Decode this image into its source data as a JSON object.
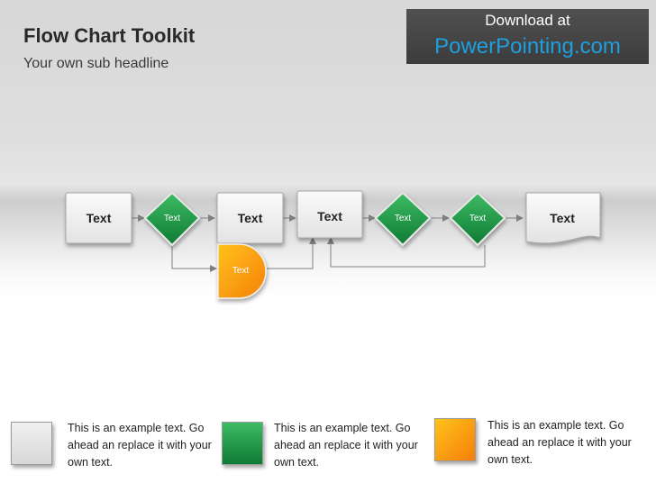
{
  "header": {
    "title": "Flow Chart Toolkit",
    "subtitle": "Your own sub headline"
  },
  "banner": {
    "line1": "Download at",
    "line2": "PowerPointing.com"
  },
  "flow": {
    "nodes": [
      {
        "id": "process-1",
        "shape": "process",
        "label": "Text"
      },
      {
        "id": "decision-1",
        "shape": "decision",
        "label": "Text"
      },
      {
        "id": "process-2",
        "shape": "process",
        "label": "Text"
      },
      {
        "id": "process-3",
        "shape": "process",
        "label": "Text"
      },
      {
        "id": "decision-2",
        "shape": "decision",
        "label": "Text"
      },
      {
        "id": "decision-3",
        "shape": "decision",
        "label": "Text"
      },
      {
        "id": "document-1",
        "shape": "document",
        "label": "Text"
      },
      {
        "id": "delay-1",
        "shape": "delay",
        "label": "Text"
      }
    ]
  },
  "legend": [
    {
      "text": "This is an example text. Go ahead an replace it with your own text.",
      "color": "#e2e2e2"
    },
    {
      "text": "This is an example text. Go ahead an replace it with your own text.",
      "color": "#1f9c4a"
    },
    {
      "text": "This is an example text. Go ahead an replace it with your own text.",
      "color": "#fba212"
    }
  ],
  "colors": {
    "green": "#1f9c4a",
    "orange": "#fba212",
    "gray": "#e2e2e2",
    "connector": "#7f7f7f",
    "banner_link": "#1e9fe0"
  }
}
